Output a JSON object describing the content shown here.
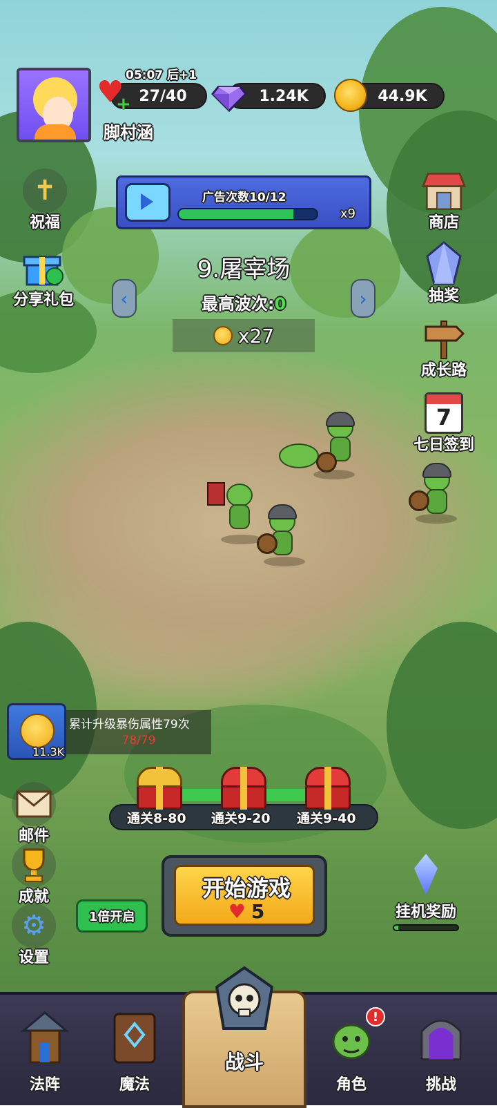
{
  "header": {
    "player_name": "脚村涵",
    "energy_timer": "05:07 后+1",
    "hearts": "27/40",
    "gems": "1.24K",
    "gold": "44.9K"
  },
  "left_menu": [
    {
      "label": "祝福",
      "icon": "cross-icon"
    },
    {
      "label": "分享礼包",
      "icon": "gift-share-icon"
    }
  ],
  "right_menu": [
    {
      "label": "商店",
      "icon": "shop-icon"
    },
    {
      "label": "抽奖",
      "icon": "crystal-icon"
    },
    {
      "label": "成长路",
      "icon": "signpost-icon"
    },
    {
      "label": "七日签到",
      "icon": "calendar-icon",
      "calendar_day": "7"
    }
  ],
  "ad": {
    "label": "广告次数10/12",
    "progress": 0.83,
    "multiplier": "x9"
  },
  "stage": {
    "name": "9.屠宰场",
    "best_wave_label": "最高波次:",
    "best_wave_value": "0",
    "reward": "x27"
  },
  "achievement": {
    "amount": "11.3K",
    "description": "累计升级暴伤属性79次",
    "progress": "78/79"
  },
  "chests": {
    "progress": 0.9,
    "items": [
      {
        "label": "通关8-80"
      },
      {
        "label": "通关9-20"
      },
      {
        "label": "通关9-40"
      }
    ]
  },
  "lower_left_menu": [
    {
      "label": "邮件",
      "icon": "mail-icon"
    },
    {
      "label": "成就",
      "icon": "trophy-icon"
    },
    {
      "label": "设置",
      "icon": "gear-icon"
    }
  ],
  "start": {
    "label": "开始游戏",
    "cost": "5"
  },
  "speed_button": "1倍开启",
  "idle_reward": {
    "label": "挂机奖励",
    "progress": 0.06
  },
  "bottom_nav": [
    {
      "label": "法阵",
      "icon": "tower-icon"
    },
    {
      "label": "魔法",
      "icon": "spellbook-icon"
    },
    {
      "label": "战斗",
      "icon": "skull-swords-icon"
    },
    {
      "label": "角色",
      "icon": "goblin-icon",
      "badge": "!"
    },
    {
      "label": "挑战",
      "icon": "portal-icon"
    }
  ],
  "colors": {
    "accent_green": "#3fc94f",
    "heart_red": "#e32b2b",
    "gold": "#f5b51d",
    "ad_blue": "#4d6be0"
  }
}
